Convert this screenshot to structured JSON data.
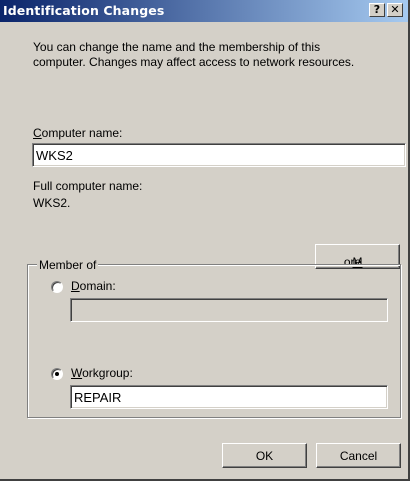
{
  "dialog": {
    "title": "Identification Changes",
    "help_label": "?",
    "close_label": "✕",
    "description_line1": "You can change the name and the membership of this",
    "description_line2": "computer. Changes may affect access to network resources."
  },
  "computer_name": {
    "label_access": "C",
    "label_rest": "omputer name:",
    "value": "WKS2"
  },
  "full_name": {
    "label": "Full computer name:",
    "value": "WKS2."
  },
  "more_button": {
    "access": "M",
    "rest": "ore..."
  },
  "member_of": {
    "legend": "Member of",
    "domain": {
      "access": "D",
      "rest": "omain:",
      "value": "",
      "selected": false
    },
    "workgroup": {
      "access": "W",
      "rest": "orkgroup:",
      "value": "REPAIR",
      "selected": true
    }
  },
  "buttons": {
    "ok": "OK",
    "cancel": "Cancel"
  }
}
